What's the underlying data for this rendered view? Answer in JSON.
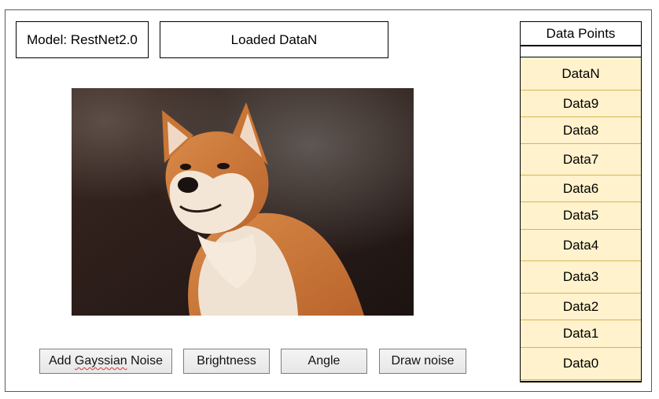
{
  "header": {
    "model_label": "Model: RestNet2.0",
    "loaded_label": "Loaded DataN"
  },
  "image": {
    "subject": "shiba-inu-dog",
    "colors": {
      "background_dark": "#2a1c18",
      "fur_orange": "#d07a3a",
      "fur_cream": "#f3e6d6"
    }
  },
  "buttons": {
    "noise_prefix": "Add ",
    "noise_misspelled": "Gayssian",
    "noise_suffix": " Noise",
    "brightness": "Brightness",
    "angle": "Angle",
    "draw_noise": "Draw noise"
  },
  "data_points": {
    "title": "Data Points",
    "items": [
      "DataN",
      "Data9",
      "Data8",
      "Data7",
      "Data6",
      "Data5",
      "Data4",
      "Data3",
      "Data2",
      "Data1",
      "Data0"
    ],
    "fill_color": "#fff2cc",
    "border_color": "#d6b656"
  }
}
